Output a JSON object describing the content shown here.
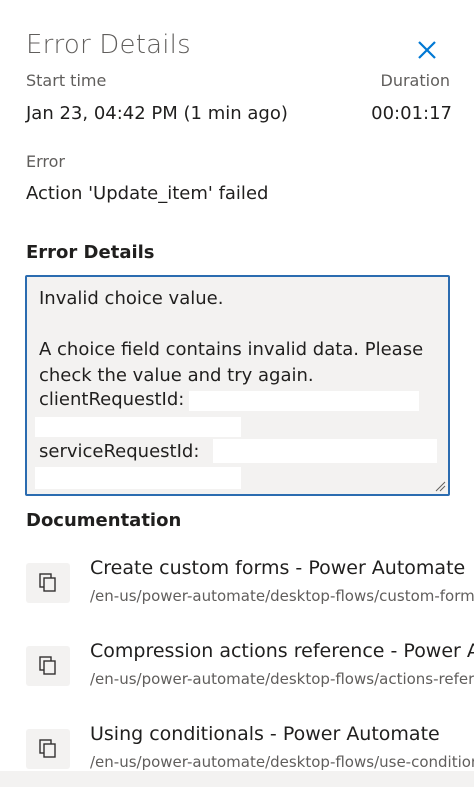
{
  "panel": {
    "title": "Error Details",
    "close_icon": "close-icon"
  },
  "run": {
    "start_label": "Start time",
    "start_value": "Jan 23, 04:42 PM (1 min ago)",
    "duration_label": "Duration",
    "duration_value": "00:01:17"
  },
  "error": {
    "label": "Error",
    "value": "Action 'Update_item' failed"
  },
  "details": {
    "label": "Error Details",
    "line1": "Invalid choice value.",
    "line2": "A choice field contains invalid data. Please",
    "line3": "check the value and try again.",
    "line4": "clientRequestId:",
    "line5": "serviceRequestId:"
  },
  "documentation": {
    "label": "Documentation",
    "items": [
      {
        "title": "Create custom forms - Power Automate",
        "url": "/en-us/power-automate/desktop-flows/custom-forms",
        "icon": "document-copy-icon"
      },
      {
        "title": "Compression actions reference - Power Automate",
        "url": "/en-us/power-automate/desktop-flows/actions-reference",
        "icon": "document-copy-icon"
      },
      {
        "title": "Using conditionals - Power Automate",
        "url": "/en-us/power-automate/desktop-flows/use-conditionals",
        "icon": "document-copy-icon"
      }
    ]
  },
  "colors": {
    "accent": "#2b6cb0",
    "close": "#0078d4"
  }
}
